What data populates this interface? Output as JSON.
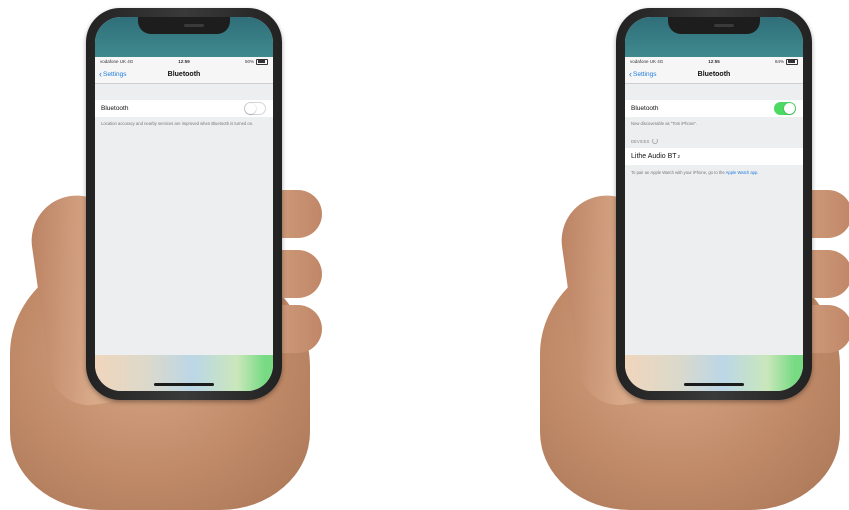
{
  "phones": [
    {
      "status": {
        "carrier": "vodafone UK  4G",
        "time": "12:59",
        "battery": "50%"
      },
      "nav": {
        "back_label": "Settings",
        "title": "Bluetooth"
      },
      "bluetooth": {
        "label": "Bluetooth",
        "enabled": false
      },
      "footnote": "Location accuracy and nearby services are improved when Bluetooth is turned on."
    },
    {
      "status": {
        "carrier": "vodafone UK  4G",
        "time": "12:55",
        "battery": "84%"
      },
      "nav": {
        "back_label": "Settings",
        "title": "Bluetooth"
      },
      "bluetooth": {
        "label": "Bluetooth",
        "enabled": true
      },
      "discoverable": "Now discoverable as \"Tom iPhone\".",
      "devices_header": "DEVICES",
      "device": {
        "name": "Lithe Audio BT",
        "superscript": "2"
      },
      "footnote_text": "To pair an Apple Watch with your iPhone, go to the ",
      "footnote_link": "Apple Watch app."
    }
  ],
  "colors": {
    "accent": "#1f7bd8",
    "toggle_on": "#4cd964"
  }
}
